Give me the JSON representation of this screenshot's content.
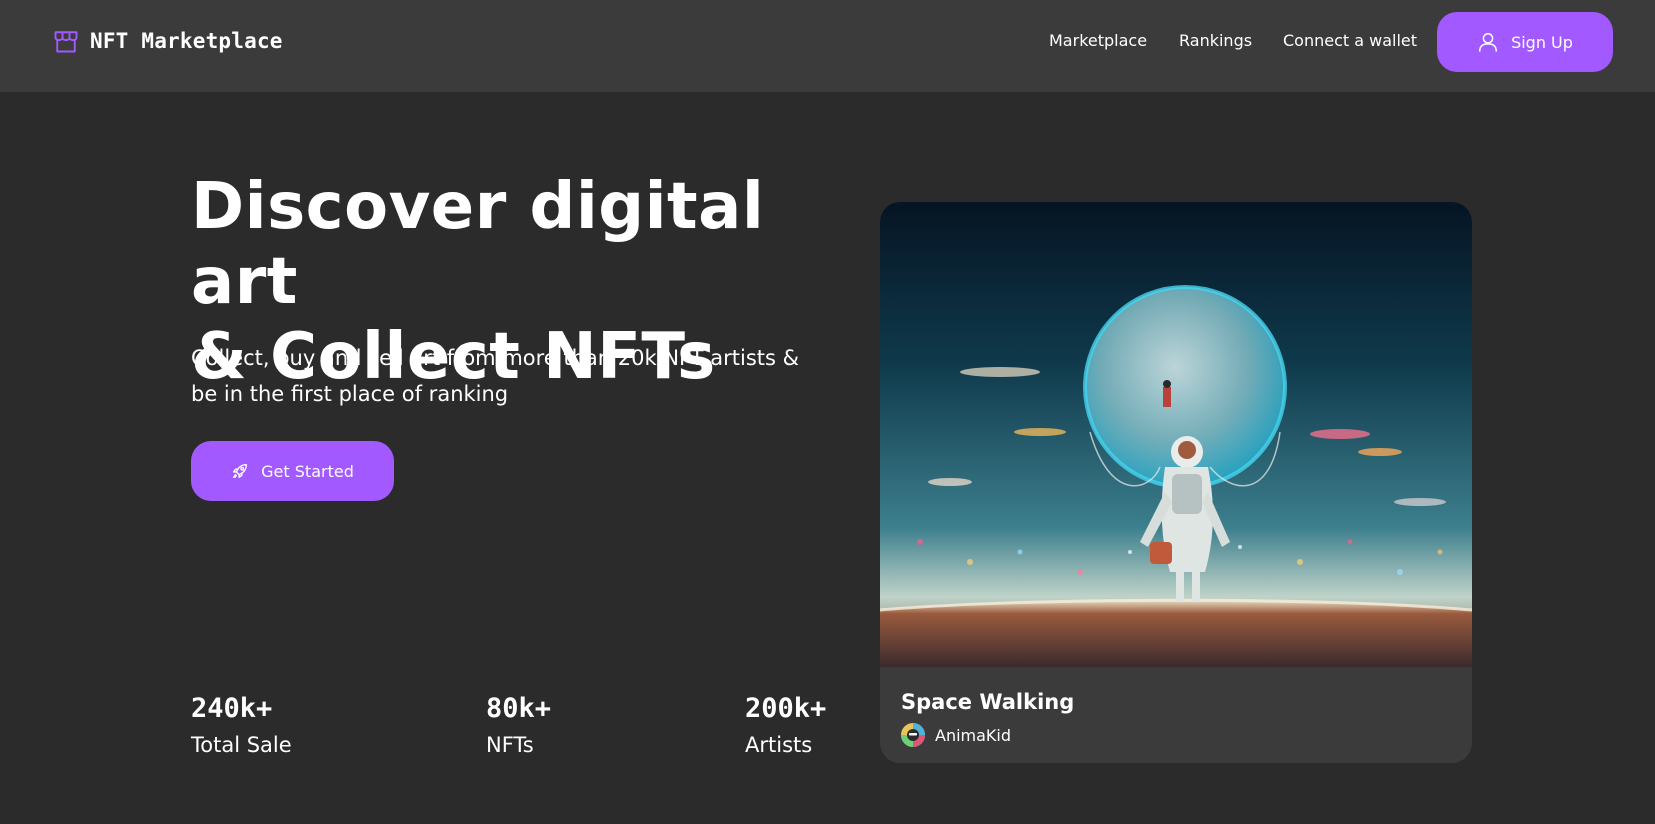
{
  "header": {
    "brand_name": "NFT Marketplace",
    "brand_icon": "storefront-icon",
    "nav": [
      {
        "label": "Marketplace"
      },
      {
        "label": "Rankings"
      },
      {
        "label": "Connect a wallet"
      }
    ],
    "signup_label": "Sign Up",
    "signup_icon": "user-icon"
  },
  "hero": {
    "title_line1": "Discover digital art",
    "title_line2": "& Collect NFTs",
    "subtitle_line1": "Collect, buy and sell art from more than 20k NFT artists &",
    "subtitle_line2": "be in the first place of ranking",
    "cta_label": "Get Started",
    "cta_icon": "rocket-icon"
  },
  "stats": [
    {
      "value": "240k+",
      "label": "Total Sale"
    },
    {
      "value": "80k+",
      "label": "NFTs"
    },
    {
      "value": "200k+",
      "label": "Artists"
    }
  ],
  "featured": {
    "title": "Space Walking",
    "artist": "AnimaKid",
    "image_icon": "astronaut-artwork-icon"
  },
  "colors": {
    "accent": "#a259ff",
    "background": "#2b2b2b",
    "surface": "#3b3b3b",
    "text": "#ffffff"
  }
}
